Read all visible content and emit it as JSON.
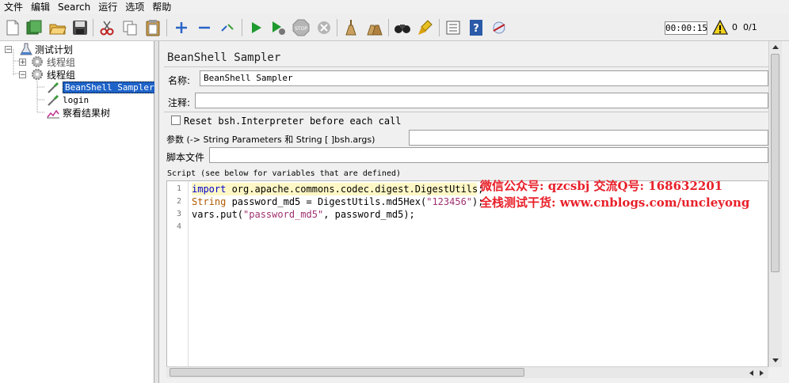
{
  "menu": [
    "文件",
    "编辑",
    "Search",
    "运行",
    "选项",
    "帮助"
  ],
  "toolbar": {
    "timer": "00:00:15",
    "warning_count": "0",
    "thread_ratio": "0/1",
    "icons": [
      "new-icon",
      "templates-icon",
      "open-icon",
      "save-icon",
      "cut-icon",
      "copy-icon",
      "paste-icon",
      "expand-icon",
      "collapse-icon",
      "toggle-icon",
      "start-icon",
      "start-no-pause-icon",
      "stop-icon",
      "shutdown-icon",
      "clear-icon",
      "clear-all-icon",
      "search-icon",
      "reset-search-icon",
      "function-helper-icon",
      "help-icon",
      "remote-icon"
    ]
  },
  "tree": {
    "test_plan": "测试计划",
    "thread_group_1": "线程组",
    "thread_group_2": "线程组",
    "beanshell": "BeanShell Sampler",
    "login": "login",
    "result_tree": "察看结果树"
  },
  "sampler": {
    "title": "BeanShell Sampler",
    "name_label": "名称:",
    "name_value": "BeanShell Sampler",
    "comment_label": "注释:",
    "comment_value": "",
    "reset_label": "Reset bsh.Interpreter before each call",
    "params_label": "参数 (-> String Parameters 和 String [ ]bsh.args)",
    "params_value": "",
    "script_file_label": "脚本文件",
    "script_file_value": "",
    "script_label": "Script (see below for variables that are defined)"
  },
  "code": {
    "line_numbers": [
      "1",
      "2",
      "3",
      "4"
    ],
    "line1_kw": "import",
    "line1_rest": " org.apache.commons.codec.digest.DigestUtils;",
    "line2_type": "String",
    "line2_mid": " password_md5 = DigestUtils.md5Hex(",
    "line2_str": "\"123456\"",
    "line2_end": ");",
    "line3_start": "vars.put(",
    "line3_str": "\"password_md5\"",
    "line3_end": ", password_md5);"
  },
  "watermark": {
    "line1": "微信公众号: qzcsbj   交流Q号: 168632201",
    "line2": "全栈测试干货: www.cnblogs.com/uncleyong"
  }
}
